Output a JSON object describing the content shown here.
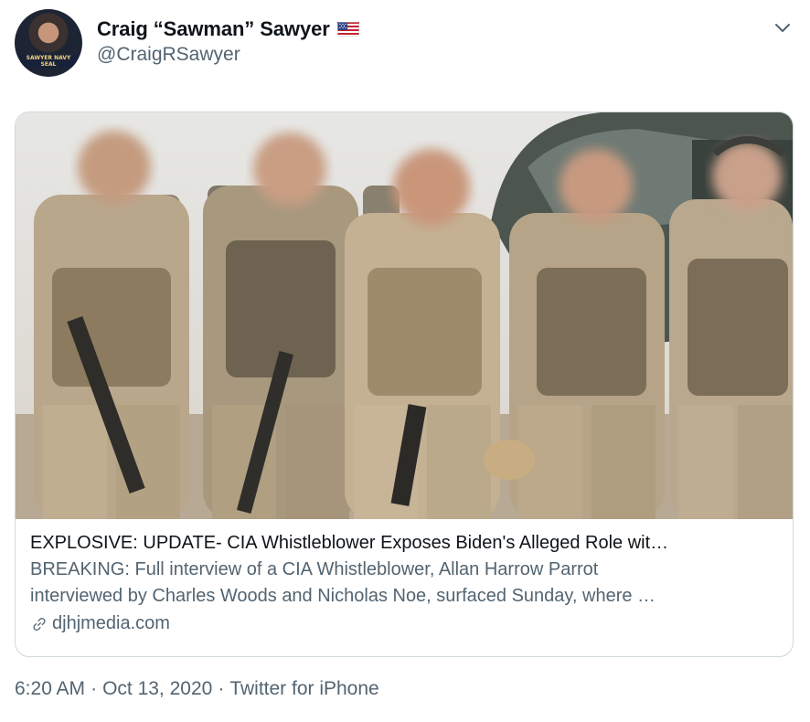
{
  "author": {
    "display_name": "Craig “Sawman” Sawyer",
    "handle": "@CraigRSawyer",
    "avatar_caption": "SAWYER NAVY SEAL",
    "flag_icon": "us-flag-icon"
  },
  "card": {
    "title": "EXPLOSIVE: UPDATE- CIA Whistleblower Exposes Biden's Alleged Role wit…",
    "description_line1": "BREAKING: Full interview of a CIA Whistleblower, Allan Harrow Parrot",
    "description_line2": "interviewed by Charles Woods and Nicholas Noe, surfaced Sunday, where …",
    "domain": "djhjmedia.com",
    "link_icon": "link-icon"
  },
  "meta": {
    "time": "6:20 AM",
    "separator1": "·",
    "date": "Oct 13, 2020",
    "separator2": "·",
    "source": "Twitter for iPhone"
  },
  "colors": {
    "text_primary": "#0f1419",
    "text_secondary": "#536471",
    "border": "#cfd9de"
  }
}
